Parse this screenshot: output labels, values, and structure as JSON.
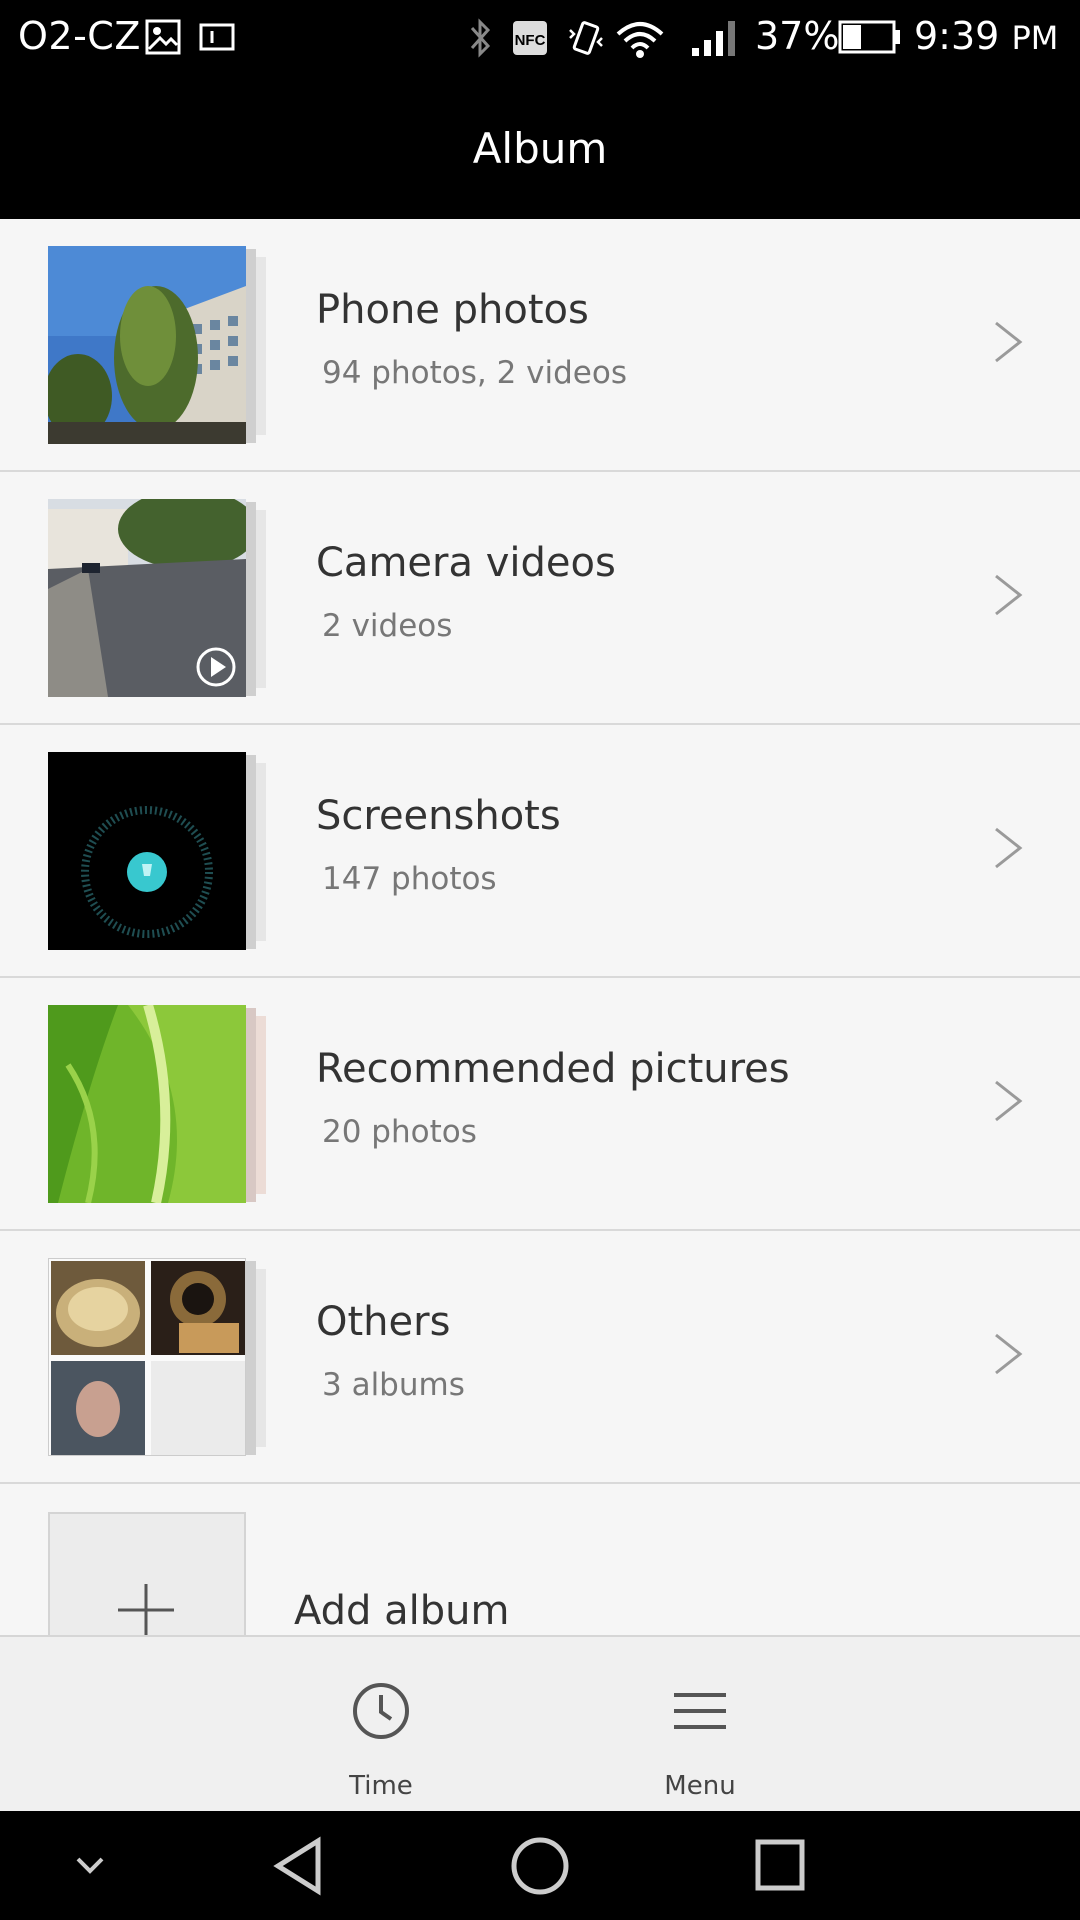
{
  "status_bar": {
    "carrier": "O2-CZ",
    "battery_percent": "37%",
    "time": "9:39",
    "time_suffix": "PM",
    "icons": [
      "image-icon",
      "input-icon",
      "bluetooth-icon",
      "nfc-icon",
      "vibrate-icon",
      "wifi-icon",
      "signal-icon",
      "battery-icon"
    ]
  },
  "header": {
    "title": "Album"
  },
  "albums": [
    {
      "name": "Phone photos",
      "count": "94 photos,  2 videos"
    },
    {
      "name": "Camera videos",
      "count": "2 videos"
    },
    {
      "name": "Screenshots",
      "count": "147 photos"
    },
    {
      "name": "Recommended pictures",
      "count": "20 photos"
    },
    {
      "name": "Others",
      "count": "3 albums"
    }
  ],
  "add_album": {
    "label": "Add album"
  },
  "bottom_tabs": [
    {
      "label": "Time",
      "icon": "clock-icon"
    },
    {
      "label": "Menu",
      "icon": "menu-icon"
    }
  ],
  "nav_bar": {
    "icons": [
      "hide-nav-icon",
      "back-icon",
      "home-icon",
      "recents-icon"
    ]
  },
  "colors": {
    "bar_bg": "#000000",
    "list_bg": "#f6f6f6",
    "divider": "#d9d9d9",
    "accent_teal": "#38c8cf"
  }
}
